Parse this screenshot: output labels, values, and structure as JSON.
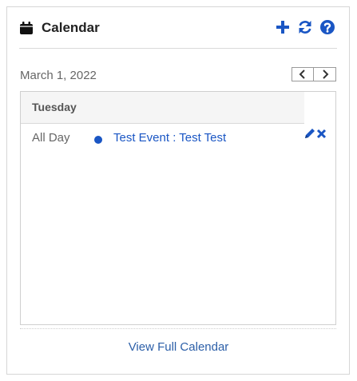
{
  "widget": {
    "title": "Calendar",
    "icons": {
      "calendar": "calendar-icon",
      "add": "plus-icon",
      "refresh": "refresh-icon",
      "help": "help-icon"
    }
  },
  "date_nav": {
    "date": "March 1, 2022",
    "prev_icon": "chevron-left-icon",
    "next_icon": "chevron-right-icon"
  },
  "day": {
    "name": "Tuesday",
    "events": [
      {
        "time": "All Day",
        "title": "Test Event : Test Test",
        "color": "#1a56c4",
        "edit_icon": "pencil-icon",
        "delete_icon": "close-icon"
      }
    ]
  },
  "footer": {
    "link": "View Full Calendar"
  },
  "colors": {
    "accent": "#1a56c4",
    "link": "#2c5fa8",
    "header_bg": "#f5f5f5"
  }
}
